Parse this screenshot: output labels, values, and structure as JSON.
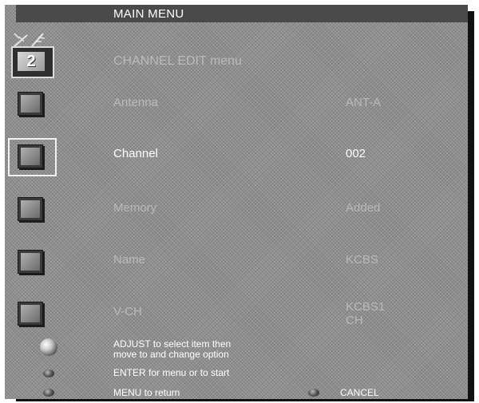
{
  "header": {
    "title": "MAIN MENU"
  },
  "submenu": {
    "title": "CHANNEL EDIT menu",
    "icon_number": "2"
  },
  "rows": [
    {
      "label": "Antenna",
      "value": "ANT-A"
    },
    {
      "label": "Channel",
      "value": "002"
    },
    {
      "label": "Memory",
      "value": "Added"
    },
    {
      "label": "Name",
      "value": "KCBS"
    },
    {
      "label": "V-CH",
      "value_line1": "KCBS1",
      "value_line2": "CH"
    }
  ],
  "help": {
    "adjust_line1": "ADJUST to select item then",
    "adjust_line2": "move to and change option",
    "enter": "ENTER for menu or to start",
    "menu": "MENU to return",
    "cancel": "CANCEL"
  },
  "colors": {
    "panel": "#8e8e8e",
    "title_bar": "#4a4a4a",
    "highlight": "#f2f2f2"
  },
  "icons": [
    "antenna-icon",
    "tv-icon",
    "adjust-knob-icon",
    "enter-button-icon",
    "menu-button-icon",
    "cancel-button-icon"
  ]
}
